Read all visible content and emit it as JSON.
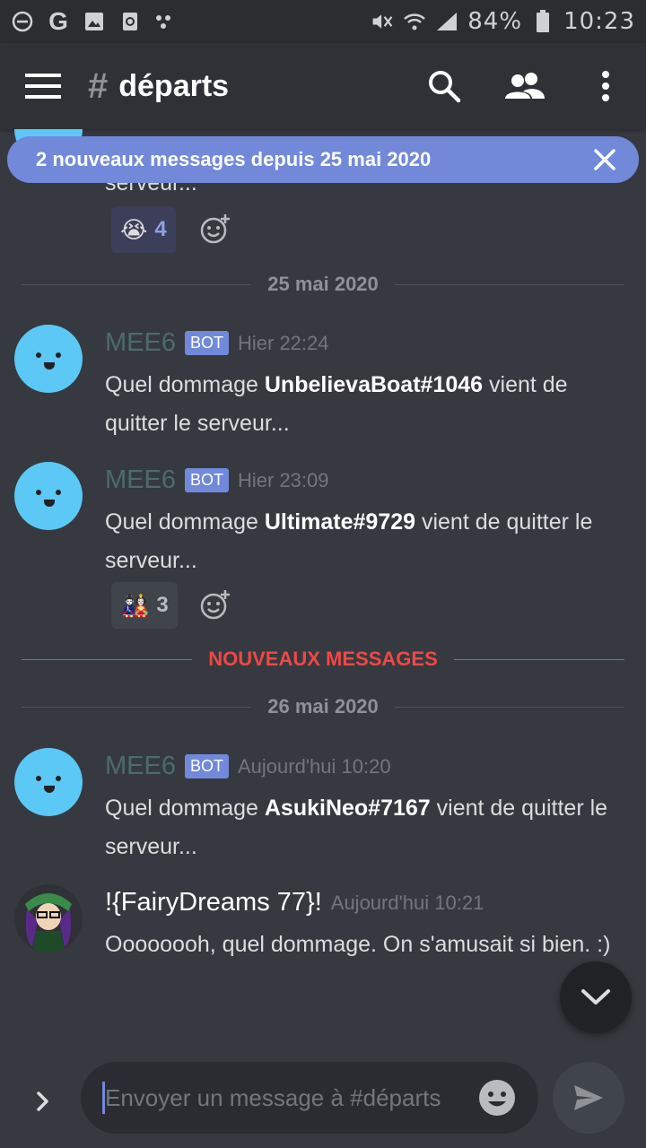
{
  "status_bar": {
    "battery": "84%",
    "time": "10:23",
    "left_icons": [
      "minus-circle-icon",
      "google-icon",
      "image-icon",
      "recycle-icon",
      "dots-icon"
    ],
    "right_icons": [
      "mute-icon",
      "wifi-icon",
      "signal-icon",
      "battery-icon"
    ]
  },
  "header": {
    "hash": "#",
    "channel": "départs",
    "icons": [
      "menu-icon",
      "search-icon",
      "members-icon",
      "more-vert-icon"
    ]
  },
  "banner": {
    "text": "2 nouveaux messages depuis 25 mai 2020",
    "close_icon": "close-icon"
  },
  "partial_message": {
    "text": "serveur...",
    "reaction": {
      "emoji": "😭",
      "count": "4"
    }
  },
  "dividers": {
    "date1": "25 mai 2020",
    "new_messages": "NOUVEAUX MESSAGES",
    "date2": "26 mai 2020"
  },
  "messages": [
    {
      "author": "MEE6",
      "bot_tag": "BOT",
      "timestamp": "Hier 22:24",
      "prefix": "Quel dommage ",
      "bold": "UnbelievaBoat#1046",
      "suffix": " vient de quitter le serveur..."
    },
    {
      "author": "MEE6",
      "bot_tag": "BOT",
      "timestamp": "Hier 23:09",
      "prefix": "Quel dommage ",
      "bold": "Ultimate#9729",
      "suffix": " vient de quitter le serveur...",
      "reaction": {
        "emoji": "🎎",
        "count": "3"
      }
    },
    {
      "author": "MEE6",
      "bot_tag": "BOT",
      "timestamp": "Aujourd'hui 10:20",
      "prefix": "Quel dommage ",
      "bold": "AsukiNeo#7167",
      "suffix": " vient de quitter le serveur..."
    },
    {
      "author": "!{FairyDreams 77}!",
      "timestamp": "Aujourd'hui 10:21",
      "text": "Oooooooh, quel dommage. On s'amusait si bien. :)"
    }
  ],
  "composer": {
    "placeholder": "Envoyer un message à #départs",
    "value": ""
  },
  "colors": {
    "background": "#36393f",
    "header": "#2f3136",
    "blurple": "#7289da",
    "new_red": "#f04747",
    "avatar_blue": "#5bc8f5"
  }
}
